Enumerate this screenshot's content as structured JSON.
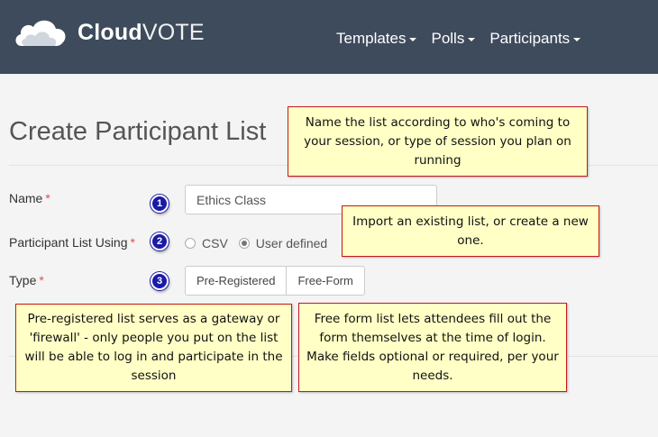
{
  "header": {
    "brand_bold": "Cloud",
    "brand_light": "VOTE",
    "nav": [
      {
        "label": "Templates"
      },
      {
        "label": "Polls"
      },
      {
        "label": "Participants"
      }
    ]
  },
  "page": {
    "title": "Create Participant List"
  },
  "form": {
    "name_label": "Name",
    "name_value": "Ethics Class",
    "using_label": "Participant List Using",
    "type_label": "Type",
    "required_mark": "*",
    "options": [
      {
        "label": "CSV",
        "checked": false
      },
      {
        "label": "User defined",
        "checked": true
      }
    ],
    "type_buttons": [
      "Pre-Registered",
      "Free-Form"
    ]
  },
  "steps": [
    "1",
    "2",
    "3"
  ],
  "callouts": {
    "name": "Name the list according to who's coming to your session, or type of session you plan on running",
    "import": "Import an existing list, or create a new one.",
    "preregistered": "Pre-registered list serves as a gateway or 'firewall' - only people you put on the list will be able to log in and participate in the session",
    "freeform": "Free form list lets attendees fill out the form themselves at the time of login. Make fields optional or required, per your needs."
  },
  "colors": {
    "header_bg": "#3e4b5c",
    "callout_bg": "#ffffc6",
    "callout_border": "#c41a1a",
    "step_badge": "#1a1aa8",
    "required": "#d9534f"
  }
}
